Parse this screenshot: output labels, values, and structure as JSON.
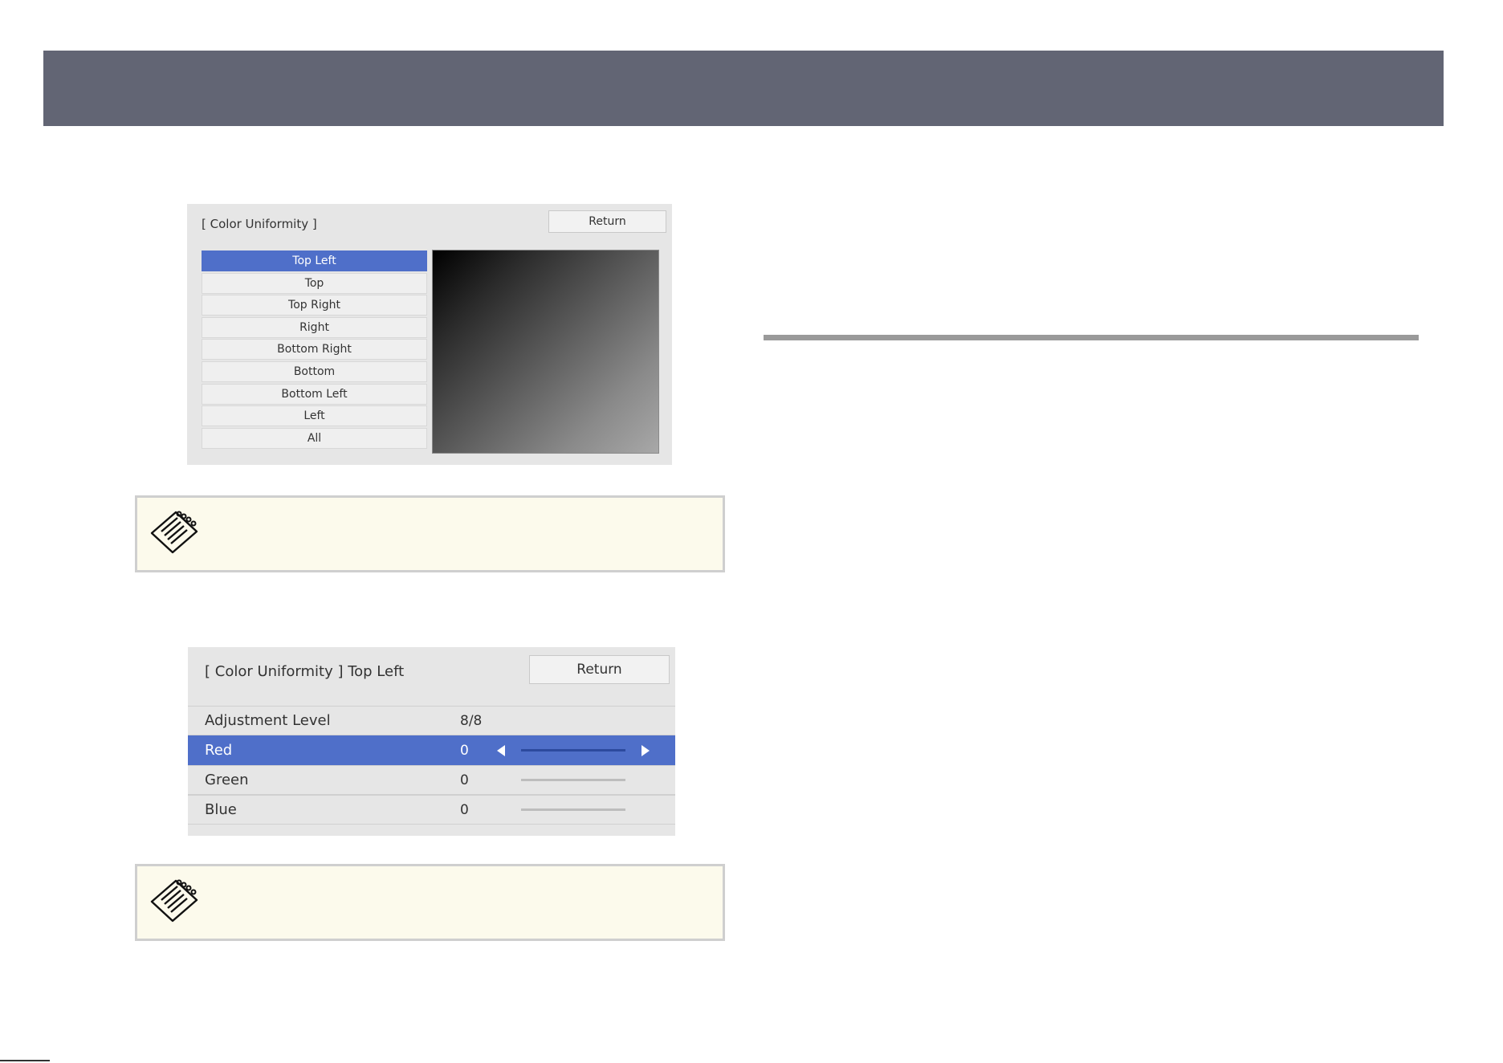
{
  "colors": {
    "header_bar": "#626574",
    "accent": "#4f6fc9",
    "note_bg": "#fcfaec",
    "panel_bg": "#e6e6e6"
  },
  "icons": {
    "note": "memo-pad-icon"
  },
  "panel1": {
    "title": "[ Color Uniformity ]",
    "return_label": "Return",
    "positions": [
      "Top Left",
      "Top",
      "Top Right",
      "Right",
      "Bottom Right",
      "Bottom",
      "Bottom Left",
      "Left",
      "All"
    ],
    "selected_index": 0
  },
  "panel2": {
    "title": "[ Color Uniformity ] Top Left",
    "return_label": "Return",
    "rows": [
      {
        "label": "Adjustment Level",
        "value": "8/8"
      },
      {
        "label": "Red",
        "value": "0"
      },
      {
        "label": "Green",
        "value": "0"
      },
      {
        "label": "Blue",
        "value": "0"
      }
    ],
    "selected_index": 1
  }
}
